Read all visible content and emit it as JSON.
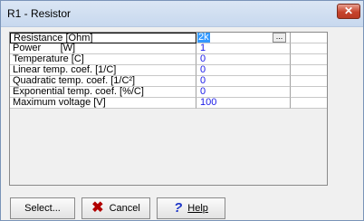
{
  "window": {
    "title": "R1 - Resistor",
    "close_glyph": "✕"
  },
  "properties": [
    {
      "name": "Resistance [Ohm]",
      "value": "2k",
      "selected": true
    },
    {
      "name": "Power       [W]",
      "value": "1"
    },
    {
      "name": "Temperature [C]",
      "value": "0"
    },
    {
      "name": "Linear temp. coef. [1/C]",
      "value": "0"
    },
    {
      "name": "Quadratic temp. coef. [1/C²]",
      "value": "0"
    },
    {
      "name": "Exponential temp. coef. [%/C]",
      "value": "0"
    },
    {
      "name": "Maximum voltage [V]",
      "value": "100"
    }
  ],
  "ellipsis_label": "...",
  "buttons": {
    "select": "Select...",
    "cancel": "Cancel",
    "help": "Help"
  },
  "icons": {
    "cancel": "x-icon",
    "help": "question-mark-icon",
    "close": "close-icon"
  },
  "colors": {
    "value_text": "#1a1ae8",
    "selection": "#3399ff",
    "close_button": "#c7432c"
  }
}
